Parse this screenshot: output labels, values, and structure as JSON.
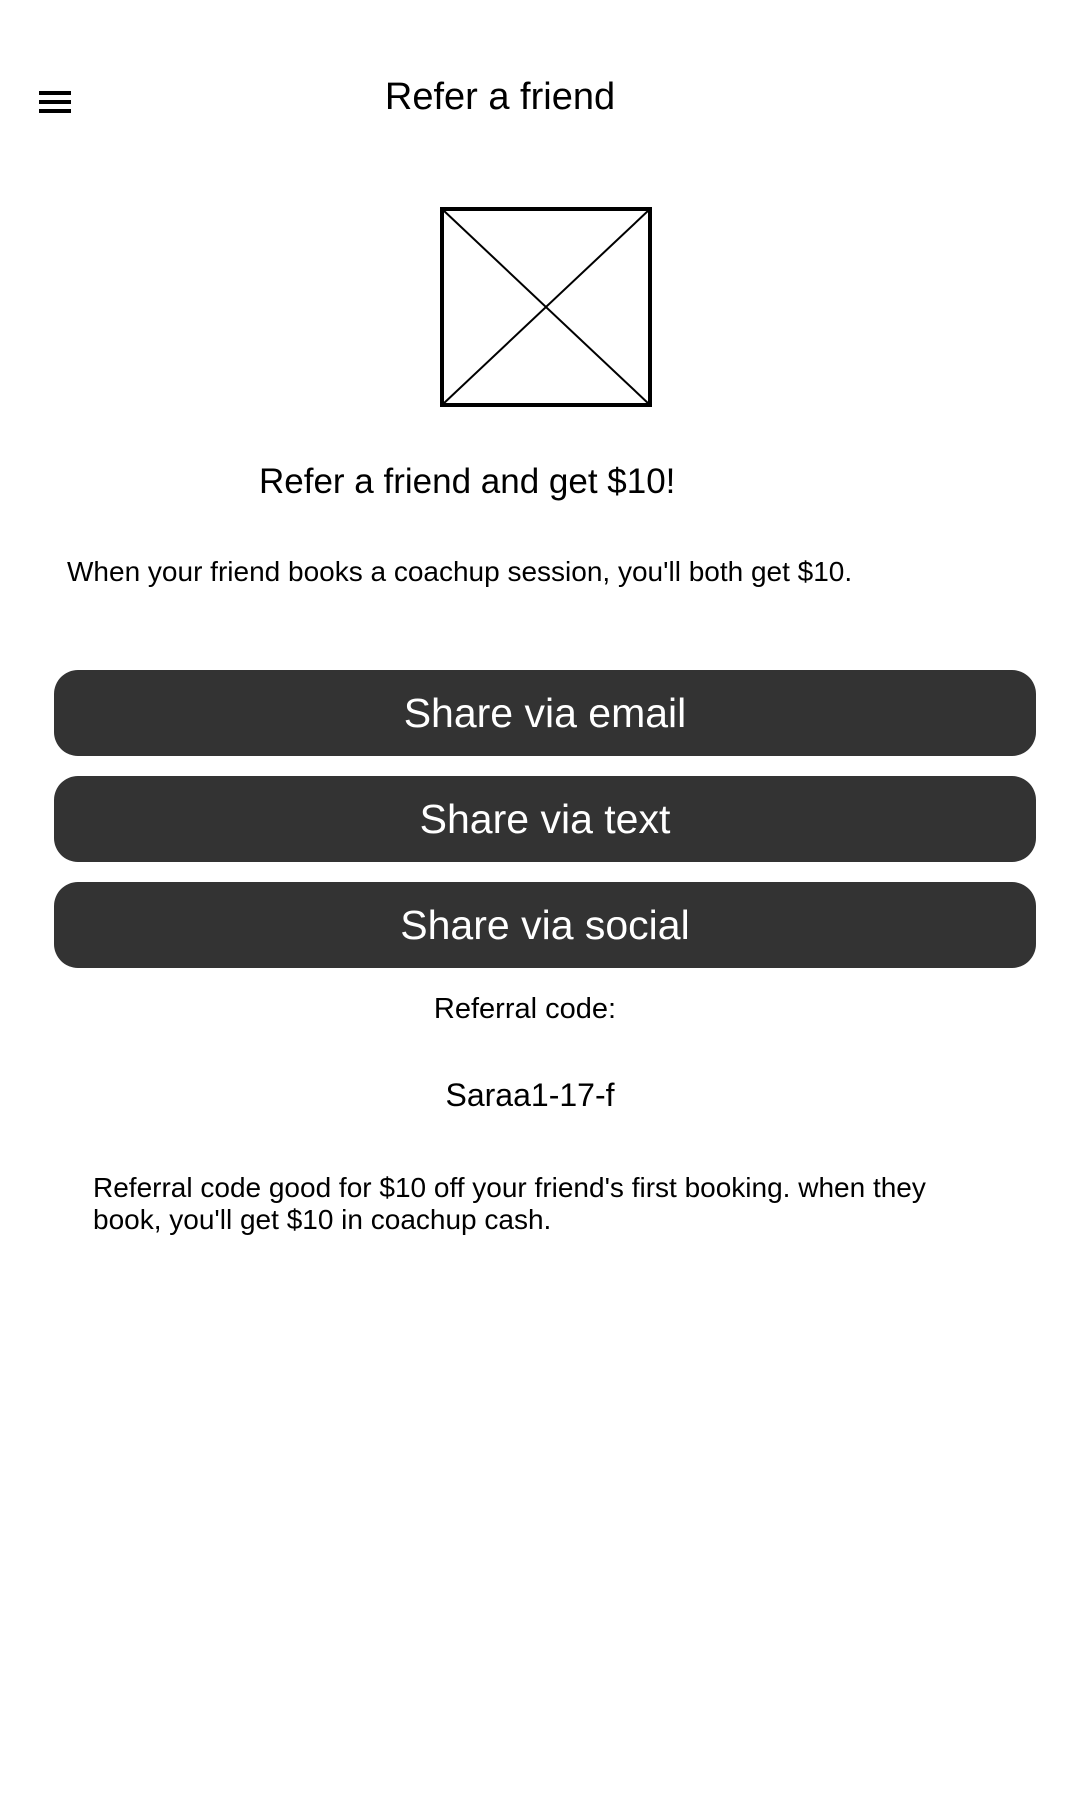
{
  "header": {
    "title": "Refer a friend",
    "menu_icon": "hamburger-menu-icon"
  },
  "hero": {
    "image_icon": "image-placeholder-icon"
  },
  "content": {
    "headline": "Refer a friend and get $10!",
    "description": "When your friend books a coachup session, you'll both get $10."
  },
  "share": {
    "email_label": "Share via email",
    "text_label": "Share via text",
    "social_label": "Share via social"
  },
  "referral": {
    "label": "Referral code:",
    "code": "Saraa1-17-f",
    "fineprint": "Referral code good for $10 off your friend's first booking. when they book, you'll get $10 in coachup cash."
  },
  "colors": {
    "button_background": "#333333",
    "button_text": "#ffffff",
    "text": "#000000",
    "background": "#ffffff"
  }
}
